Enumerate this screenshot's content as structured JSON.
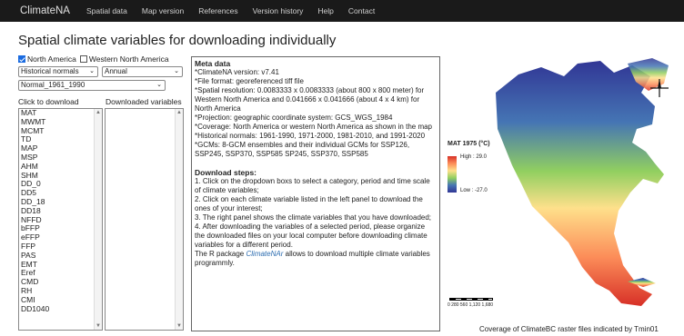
{
  "nav": {
    "brand": "ClimateNA",
    "items": [
      "Spatial data",
      "Map version",
      "References",
      "Version history",
      "Help",
      "Contact"
    ]
  },
  "title": "Spatial climate variables for downloading individually",
  "region": {
    "north_america": "North America",
    "western_north_america": "Western North America",
    "selected": "North America"
  },
  "selects": {
    "category": "Historical normals",
    "time_scale": "Annual",
    "period": "Normal_1961_1990"
  },
  "left_panel": {
    "label": "Click to download",
    "items": [
      "MAT",
      "MWMT",
      "MCMT",
      "TD",
      "MAP",
      "MSP",
      "AHM",
      "SHM",
      "DD_0",
      "DD5",
      "DD_18",
      "DD18",
      "NFFD",
      "bFFP",
      "eFFP",
      "FFP",
      "PAS",
      "EMT",
      "Eref",
      "CMD",
      "RH",
      "CMI",
      "DD1040"
    ]
  },
  "right_panel": {
    "label": "Downloaded variables",
    "items": []
  },
  "meta": {
    "title": "Meta data",
    "lines": [
      "*ClimateNA version: v7.41",
      "*File format: georeferenced tiff file",
      "*Spatial resolution: 0.0083333 x 0.0083333 (about 800 x 800 meter) for",
      "Western North America and 0.041666 x 0.041666 (about 4 x 4 km) for",
      "North America",
      "*Projection: geographic coordinate system: GCS_WGS_1984",
      "*Coverage: North America or western North America as shown in the map",
      "*Historical normals: 1961-1990, 1971-2000, 1981-2010, and 1991-2020",
      "*GCMs: 8-GCM ensembles and their individual GCMs for SSP126,",
      "SSP245, SSP370, SSP585 SP245, SSP370, SSP585"
    ],
    "steps_title": "Download steps:",
    "steps": [
      "1. Click on the dropdown boxs to select a category, period and time scale",
      "of climate variables;",
      "2. Click on each climate variable listed in the left panel to download the",
      "ones of your interest;",
      "3. The right panel shows the climate variables that you have downloaded;",
      "4. After downloading the variables of a selected period, please organize",
      "the downloaded files on your local computer before downloading climate",
      "variables for a different period."
    ],
    "r_pre": "The R package ",
    "r_link": "ClimateNAr",
    "r_post": " allows to download multiple climate variables",
    "r_line2": "programmly."
  },
  "map": {
    "legend_title": "MAT 1975 (°C)",
    "legend_high": "High : 29.0",
    "legend_low": "Low : -27.0",
    "scale_label": "0  280 560     1,120     1,680",
    "caption": "Coverage of ClimateBC raster files indicated by Tmin01",
    "colors": {
      "hot": "#d73027",
      "warm": "#fc8d59",
      "mild": "#fee08b",
      "cool": "#91cf60",
      "cold": "#4575b4",
      "frigid": "#313695"
    }
  }
}
